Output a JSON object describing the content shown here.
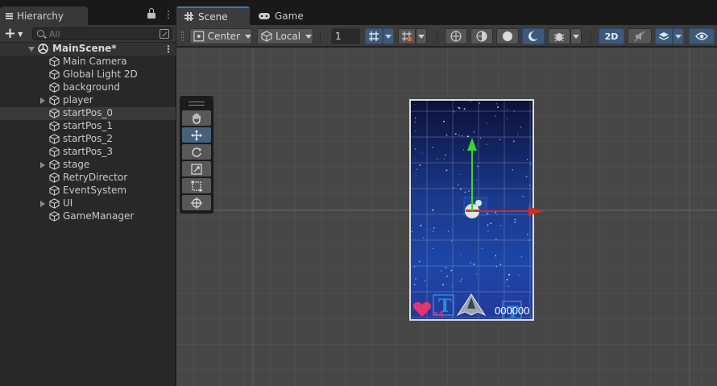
{
  "hierarchy": {
    "tab_label": "Hierarchy",
    "search_placeholder": "All",
    "scene_name": "MainScene*",
    "items": [
      {
        "label": "Main Camera",
        "has_children": false,
        "selected": false
      },
      {
        "label": "Global Light 2D",
        "has_children": false,
        "selected": false
      },
      {
        "label": "background",
        "has_children": false,
        "selected": false
      },
      {
        "label": "player",
        "has_children": true,
        "selected": false
      },
      {
        "label": "startPos_0",
        "has_children": false,
        "selected": true
      },
      {
        "label": "startPos_1",
        "has_children": false,
        "selected": false
      },
      {
        "label": "startPos_2",
        "has_children": false,
        "selected": false
      },
      {
        "label": "startPos_3",
        "has_children": false,
        "selected": false
      },
      {
        "label": "stage",
        "has_children": true,
        "selected": false
      },
      {
        "label": "RetryDirector",
        "has_children": false,
        "selected": false
      },
      {
        "label": "EventSystem",
        "has_children": false,
        "selected": false
      },
      {
        "label": "UI",
        "has_children": true,
        "selected": false
      },
      {
        "label": "GameManager",
        "has_children": false,
        "selected": false
      }
    ]
  },
  "scene_view": {
    "tabs": [
      {
        "label": "Scene",
        "icon": "grid-icon",
        "active": true
      },
      {
        "label": "Game",
        "icon": "gamepad-icon",
        "active": false
      }
    ],
    "toolbar": {
      "pivot_label": "Center",
      "space_label": "Local",
      "grid_size": "1",
      "mode_2d_label": "2D"
    },
    "game_hud": {
      "lives": "×4",
      "score": "000000"
    }
  },
  "colors": {
    "selection_bg": "#3a3a3a",
    "accent_blue": "#3a79bb",
    "grid_bg": "#474747",
    "gizmo_x": "#d42a2a",
    "gizmo_y": "#3bd42a",
    "heart": "#e8336e",
    "ui_text_icon": "#2a8ae0"
  }
}
